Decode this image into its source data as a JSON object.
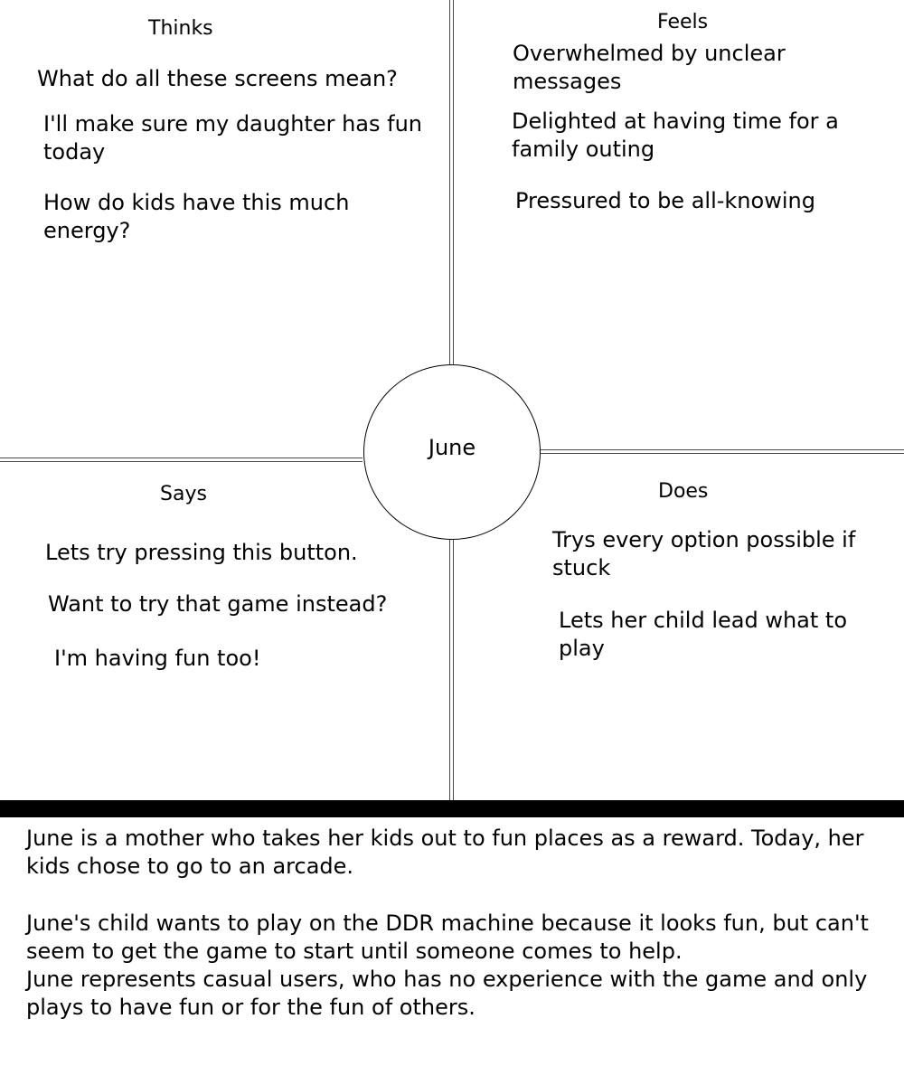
{
  "persona": {
    "name": "June"
  },
  "quadrants": {
    "thinks": {
      "title": "Thinks",
      "notes": [
        "What do all these screens mean?",
        "I'll make sure my daughter has fun today",
        "How do kids have this much energy?"
      ]
    },
    "feels": {
      "title": "Feels",
      "notes": [
        "Overwhelmed by unclear messages",
        "Delighted at having time for a family outing",
        "Pressured to be all-knowing"
      ]
    },
    "says": {
      "title": "Says",
      "notes": [
        "Lets try pressing this button.",
        "Want to try that game instead?",
        "I'm having fun too!"
      ]
    },
    "does": {
      "title": "Does",
      "notes": [
        "Trys every option possible if stuck",
        "Lets her child lead what to play"
      ]
    }
  },
  "description": {
    "paragraphs": [
      "June is a mother who takes her kids out to fun places as a reward. Today, her kids chose to go to an arcade.",
      "June's child wants to play on the DDR machine because it looks fun, but can't seem to get the game to start until someone comes to help.",
      "June represents casual users, who has no experience with the game and only plays to have fun or for the fun of others."
    ]
  }
}
